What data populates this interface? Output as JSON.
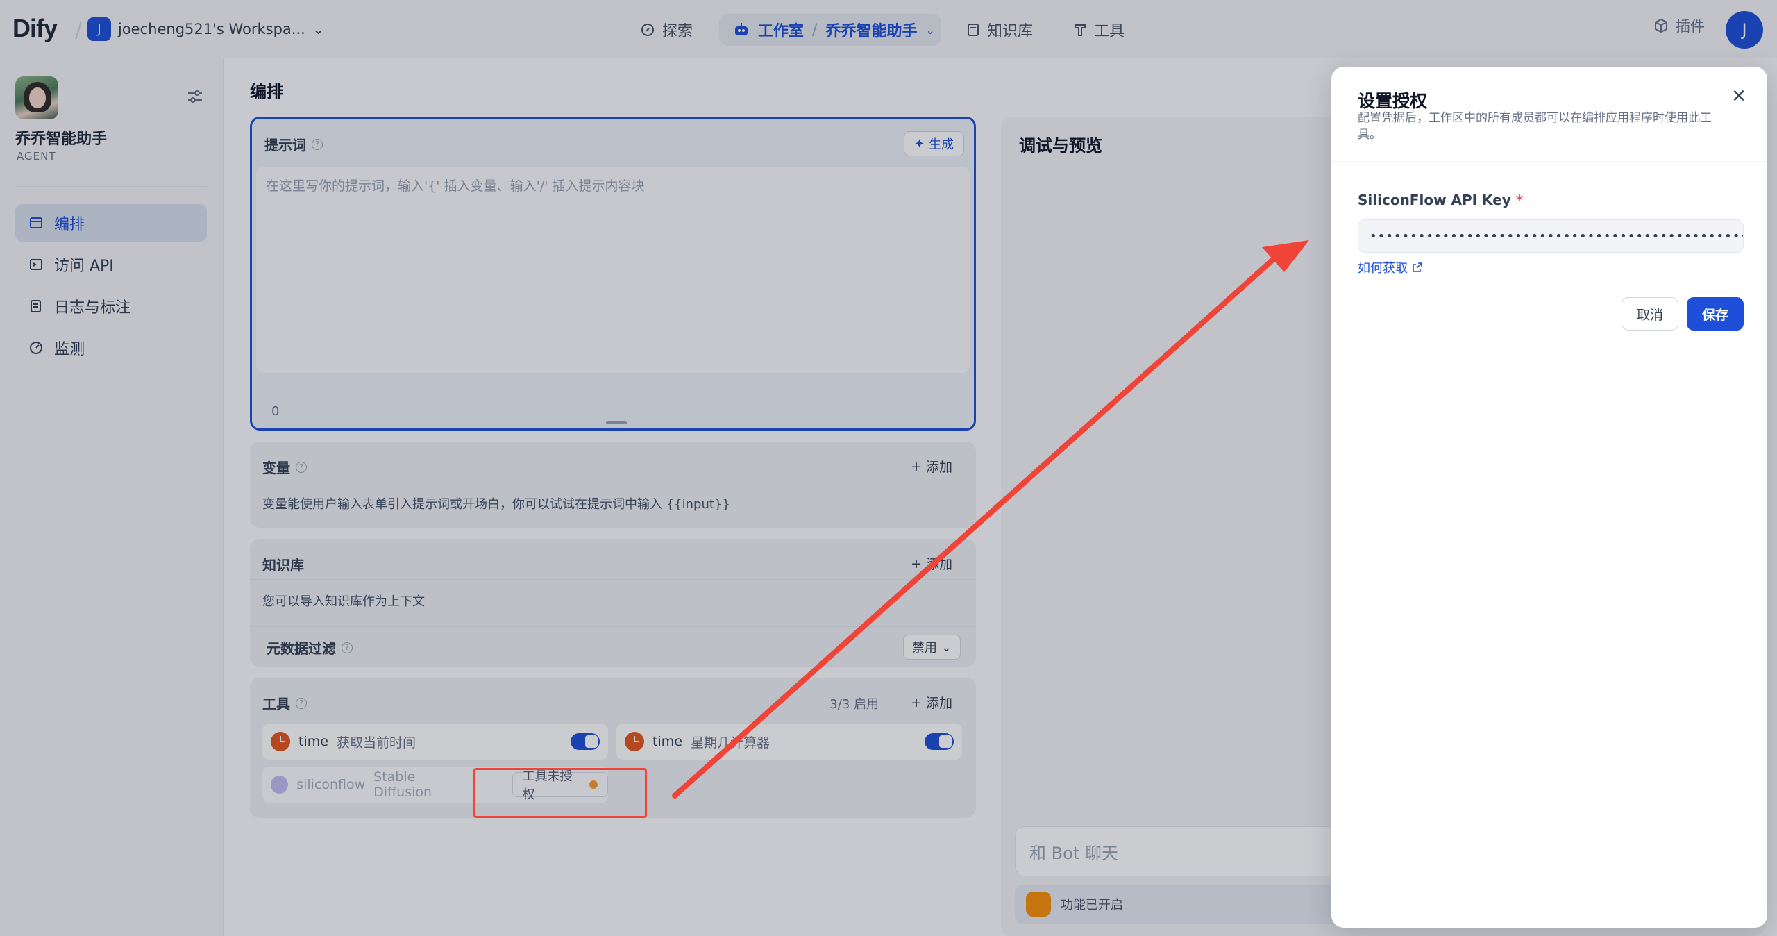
{
  "header": {
    "logo": "Dify",
    "workspace_initial": "J",
    "workspace_name": "joecheng521's Workspa...",
    "nav": {
      "explore": "探索",
      "studio": "工作室",
      "app_name": "乔乔智能助手",
      "knowledge": "知识库",
      "tools": "工具"
    },
    "plugins": "插件",
    "user_initial": "J"
  },
  "sidebar": {
    "app_name": "乔乔智能助手",
    "app_type": "AGENT",
    "items": [
      {
        "label": "编排",
        "icon": "layout-icon",
        "active": true
      },
      {
        "label": "访问 API",
        "icon": "terminal-icon",
        "active": false
      },
      {
        "label": "日志与标注",
        "icon": "file-list-icon",
        "active": false
      },
      {
        "label": "监测",
        "icon": "dashboard-icon",
        "active": false
      }
    ]
  },
  "main": {
    "title": "编排",
    "prompt": {
      "label": "提示词",
      "generate": "生成",
      "placeholder": "在这里写你的提示词，输入'{' 插入变量、输入'/' 插入提示内容块",
      "count": "0"
    },
    "variables": {
      "label": "变量",
      "add": "添加",
      "desc": "变量能使用户输入表单引入提示词或开场白，你可以试试在提示词中输入 {{input}}"
    },
    "knowledge": {
      "label": "知识库",
      "add": "添加",
      "desc": "您可以导入知识库作为上下文",
      "metadata_filter": "元数据过滤",
      "filter_value": "禁用"
    },
    "tools": {
      "label": "工具",
      "enabled_count": "3/3 启用",
      "add": "添加",
      "items": [
        {
          "provider": "time",
          "name": "获取当前时间",
          "enabled": true
        },
        {
          "provider": "time",
          "name": "星期几计算器",
          "enabled": true
        },
        {
          "provider": "siliconflow",
          "name": "Stable Diffusion",
          "status": "工具未授权"
        }
      ]
    }
  },
  "preview": {
    "title": "调试与预览",
    "chat_placeholder": "和 Bot 聊天",
    "feature_status": "功能已开启"
  },
  "modal": {
    "title": "设置授权",
    "desc": "配置凭据后，工作区中的所有成员都可以在编排应用程序时使用此工具。",
    "field_label": "SiliconFlow API Key",
    "required_mark": "*",
    "key_value": "••••••••••••••••••••••••••••••••••••••••••••••••••",
    "help_link": "如何获取",
    "cancel": "取消",
    "save": "保存"
  },
  "colors": {
    "primary": "#1d4fd8",
    "annotation": "#f04438",
    "warning": "#f79009"
  }
}
